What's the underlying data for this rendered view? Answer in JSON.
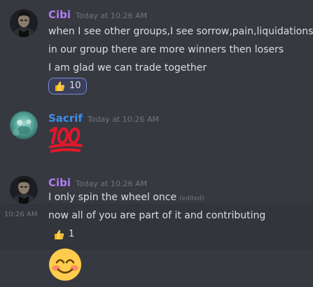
{
  "messages": [
    {
      "author": "Cibi",
      "timestamp": "Today at 10:26 AM",
      "lines": [
        "when I see other groups,I see sorrow,pain,liquidations...",
        "in our group there are more winners then losers",
        "I am glad we can trade together"
      ],
      "reaction": {
        "emoji": "thumbs-up-icon",
        "count": "10"
      }
    },
    {
      "author": "Sacrif",
      "timestamp": "Today at 10:26 AM",
      "emoji": "hundred-points-icon"
    },
    {
      "author": "Cibi",
      "timestamp": "Today at 10:26 AM",
      "line1": "I only spin the wheel once",
      "edited": "(edited)",
      "side_timestamp": "10:26 AM",
      "line2": "now all of you are part of it and contributing",
      "reaction": {
        "emoji": "thumbs-up-icon",
        "count": "1"
      },
      "emoji": "smiling-face-with-smiling-eyes-icon"
    }
  ],
  "colors": {
    "background": "#36393f",
    "hover_background": "#32353b",
    "cibi_name": "#b27cf4",
    "sacrif_name": "#3f8ee9",
    "timestamp": "#72767d",
    "text": "#dcddde",
    "reaction_active_border": "#7289da"
  }
}
